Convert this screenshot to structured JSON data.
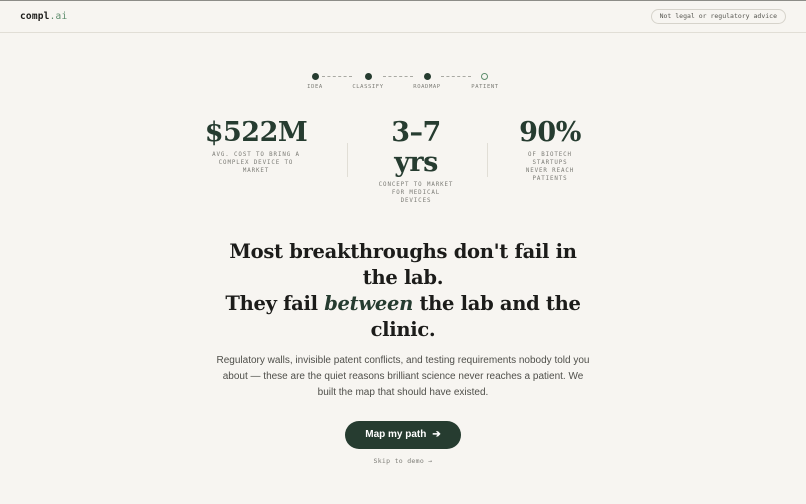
{
  "header": {
    "logo_main": "compl",
    "logo_suffix": ".ai",
    "disclaimer": "Not legal or regulatory advice"
  },
  "steps": [
    {
      "label": "IDEA",
      "state": "done"
    },
    {
      "label": "CLASSIFY",
      "state": "done"
    },
    {
      "label": "ROADMAP",
      "state": "done"
    },
    {
      "label": "PATIENT",
      "state": "pending"
    }
  ],
  "stats": [
    {
      "value": "$522M",
      "caption_lines": [
        "AVG. COST TO BRING A",
        "COMPLEX DEVICE TO",
        "MARKET"
      ]
    },
    {
      "value_lines": [
        "3–7",
        "yrs"
      ],
      "caption_lines": [
        "CONCEPT TO MARKET",
        "FOR MEDICAL",
        "DEVICES"
      ]
    },
    {
      "value": "90%",
      "caption_lines": [
        "OF BIOTECH",
        "STARTUPS",
        "NEVER REACH",
        "PATIENTS"
      ]
    }
  ],
  "headline": {
    "line1": "Most breakthroughs don't fail in the lab.",
    "line2_before": "They fail ",
    "line2_emphasis": "between",
    "line2_after": " the lab and the clinic."
  },
  "subtext": "Regulatory walls, invisible patent conflicts, and testing requirements nobody told you about — these are the quiet reasons brilliant science never reaches a patient. We built the map that should have existed.",
  "cta": {
    "label": "Map my path",
    "icon": "arrow-right-icon"
  },
  "skip_link": "Skip to demo →",
  "colors": {
    "background": "#f7f5f1",
    "accent": "#263c30",
    "accent_light": "#5e8d6d"
  }
}
